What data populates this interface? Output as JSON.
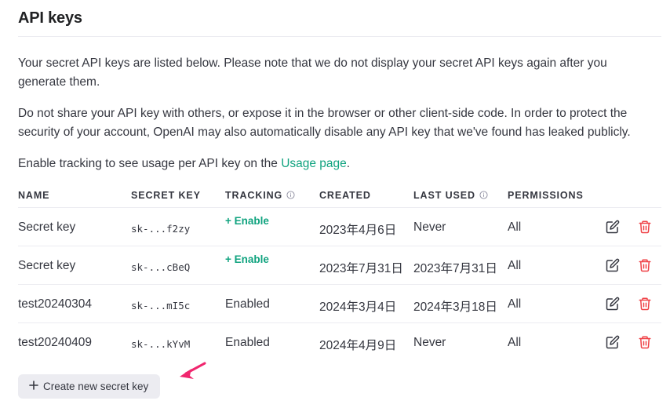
{
  "header": {
    "title": "API keys"
  },
  "intro": {
    "p1": "Your secret API keys are listed below. Please note that we do not display your secret API keys again after you generate them.",
    "p2": "Do not share your API key with others, or expose it in the browser or other client-side code. In order to protect the security of your account, OpenAI may also automatically disable any API key that we've found has leaked publicly.",
    "p3_before": "Enable tracking to see usage per API key on the ",
    "p3_link": "Usage page",
    "p3_after": "."
  },
  "table": {
    "columns": {
      "name": "NAME",
      "secret_key": "SECRET KEY",
      "tracking": "TRACKING",
      "created": "CREATED",
      "last_used": "LAST USED",
      "permissions": "PERMISSIONS"
    },
    "rows": [
      {
        "name": "Secret key",
        "secret_key": "sk-...f2zy",
        "tracking": "+ Enable",
        "created": "2023年4月6日",
        "last_used": "Never",
        "permissions": "All"
      },
      {
        "name": "Secret key",
        "secret_key": "sk-...cBeQ",
        "tracking": "+ Enable",
        "created": "2023年7月31日",
        "last_used": "2023年7月31日",
        "permissions": "All"
      },
      {
        "name": "test20240304",
        "secret_key": "sk-...mI5c",
        "tracking": "Enabled",
        "created": "2024年3月4日",
        "last_used": "2024年3月18日",
        "permissions": "All"
      },
      {
        "name": "test20240409",
        "secret_key": "sk-...kYvM",
        "tracking": "Enabled",
        "created": "2024年4月9日",
        "last_used": "Never",
        "permissions": "All"
      }
    ]
  },
  "actions": {
    "create_label": "Create new secret key"
  },
  "colors": {
    "accent": "#10a37f",
    "danger": "#ef4146",
    "annotation_arrow": "#f0266e",
    "button_bg": "#ececf1"
  },
  "icons": {
    "edit": "pencil-square-icon",
    "delete": "trash-icon",
    "info": "info-circle-icon",
    "add": "plus-icon"
  }
}
